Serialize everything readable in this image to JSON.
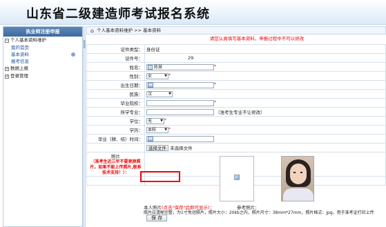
{
  "app": {
    "title": "山东省二级建造师考试报名系统"
  },
  "sidebar": {
    "header": "执业师注册申报",
    "groups": [
      {
        "label": "个人基本资料维护",
        "items": [
          "我的首页",
          "基本资料",
          "报考信息"
        ]
      },
      {
        "label": "数据上报",
        "items": []
      },
      {
        "label": "登录管理",
        "items": []
      }
    ]
  },
  "breadcrumb": "个人基本资料维护 >> 基本资料",
  "notice": "请您认真填写基本资料，申报过程中不可以修改",
  "form": {
    "cert_type_label": "证件类型：",
    "cert_type_value": "身份证",
    "cert_no_label": "证件号：",
    "cert_no_value": "29",
    "name_label": "姓名：",
    "name_value": "陈慧",
    "gender_label": "性别：",
    "gender_value": "女",
    "birth_label": "出生日期：",
    "ethnic_label": "民族：",
    "ethnic_value": "汉",
    "school_label": "毕业院校：",
    "major_label": "所学专业：",
    "major_note": "（准考生专业不让修改）",
    "degree_label": "学位：",
    "degree_value": "无",
    "edu_label": "学历：",
    "edu_value": "本科",
    "grad_time_label": "毕业（肄、结）时间：",
    "file_button": "选择文件",
    "file_status": "未选择文件",
    "photo_label": "照片",
    "photo_note": "（准考生近三年不要更换照片，如果不能上传照片,联系技术支持！）：",
    "photo_caption_prefix": "本人照片",
    "photo_caption_red": "(点击\"保存\"后即可显示)",
    "photo_caption_suffix": "：",
    "ref_caption": "参考照片：",
    "photo_requirements": "照片应清晰完整，为1寸免冠照片，照片大小：20kb之内，照片尺寸：38mm*27mm，照片格式：jpg，用于准考证打印上传",
    "save_button": "保 存"
  },
  "colors": {
    "accent": "#3c6aa0",
    "required": "#e00000",
    "highlight_box": "#e00000"
  }
}
